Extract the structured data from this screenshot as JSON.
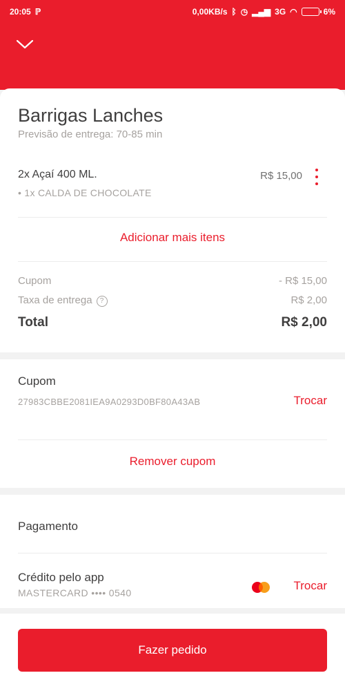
{
  "status_bar": {
    "time": "20:05",
    "speed": "0,00KB/s",
    "network": "3G",
    "battery": "6%"
  },
  "header": {
    "collapse_icon": "chevron-down-icon"
  },
  "restaurant": {
    "name": "Barrigas Lanches",
    "eta": "Previsão de entrega: 70-85 min"
  },
  "cart": {
    "items": [
      {
        "title": "2x  Açaí 400 ML.",
        "price": "R$ 15,00",
        "detail": "• 1x CALDA DE CHOCOLATE"
      }
    ],
    "add_more_label": "Adicionar mais itens"
  },
  "summary": {
    "coupon_label": "Cupom",
    "coupon_value": "- R$ 15,00",
    "delivery_label": "Taxa de entrega",
    "delivery_value": "R$ 2,00",
    "total_label": "Total",
    "total_value": "R$ 2,00"
  },
  "coupon": {
    "title": "Cupom",
    "code": "27983CBBE2081IEA9A0293D0BF80A43AB",
    "change_label": "Trocar",
    "remove_label": "Remover cupom"
  },
  "payment": {
    "title": "Pagamento",
    "method": "Crédito pelo app",
    "card": "MASTERCARD •••• 0540",
    "card_brand_icon": "mastercard-icon",
    "change_label": "Trocar"
  },
  "cta": {
    "label": "Fazer pedido"
  },
  "colors": {
    "brand_red": "#ea1d2c",
    "text_dark": "#3f3e3e",
    "text_muted": "#a6a29f"
  }
}
